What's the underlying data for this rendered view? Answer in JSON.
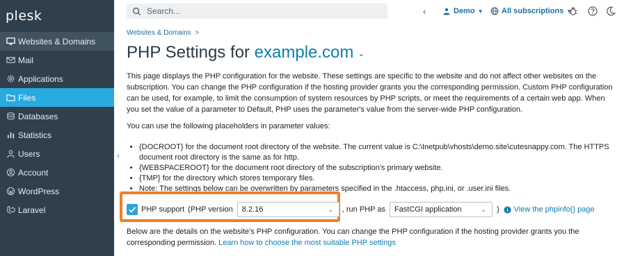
{
  "app": {
    "logo": "plesk"
  },
  "sidebar": {
    "items": [
      {
        "label": "Websites & Domains",
        "icon": "monitor-icon"
      },
      {
        "label": "Mail",
        "icon": "mail-icon"
      },
      {
        "label": "Applications",
        "icon": "gear-icon"
      },
      {
        "label": "Files",
        "icon": "folder-icon"
      },
      {
        "label": "Databases",
        "icon": "database-icon"
      },
      {
        "label": "Statistics",
        "icon": "bar-chart-icon"
      },
      {
        "label": "Users",
        "icon": "user-icon"
      },
      {
        "label": "Account",
        "icon": "account-icon"
      },
      {
        "label": "WordPress",
        "icon": "wordpress-icon"
      },
      {
        "label": "Laravel",
        "icon": "laravel-icon"
      }
    ],
    "collapse_glyph": "‹"
  },
  "header": {
    "search_placeholder": "Search...",
    "user_label": "Demo",
    "subscriptions_label": "All subscriptions"
  },
  "page": {
    "breadcrumb": "Websites & Domains",
    "breadcrumb_sep": ">",
    "title_prefix": "PHP Settings for",
    "title_domain": "example.com",
    "description": "This page displays the PHP configuration for the website. These settings are specific to the website and do not affect other websites on the subscription. You can change the PHP configuration if the hosting provider grants you the corresponding permission. Custom PHP configuration can be used, for example, to limit the consumption of system resources by PHP scripts, or meet the requirements of a certain web app. When you set the value of a parameter to Default, PHP uses the parameter's value from the server-wide PHP configuration.",
    "placeholders_intro": "You can use the following placeholders in parameter values:",
    "placeholders": [
      "{DOCROOT} for the document root directory of the website. The current value is C:\\Inetpub\\vhosts\\demo.site\\cutesnappy.com. The HTTPS document root directory is the same as for http.",
      "{WEBSPACEROOT} for the document root directory of the subscription's primary website.",
      "{TMP} for the directory which stores temporary files.",
      "Note: The settings below can be overwritten by parameters specified in the .htaccess, php.ini, or .user.ini files."
    ],
    "php_support_label": "PHP support",
    "php_version_prefix": "(PHP version",
    "php_version_value": "8.2.16",
    "run_php_as_label": ", run PHP as",
    "handler_value": "FastCGI application",
    "close_paren": ")",
    "phpinfo_link": "View the phpinfo() page",
    "below_text": "Below are the details on the website's PHP configuration. You can change the PHP configuration if the hosting provider grants you the corresponding permission.",
    "below_link": "Learn how to choose the most suitable PHP settings"
  },
  "colors": {
    "sidebar_bg": "#2f3f4c",
    "selected_item": "#28aade",
    "highlight_border": "#f47e25",
    "link": "#0c7cb0"
  }
}
